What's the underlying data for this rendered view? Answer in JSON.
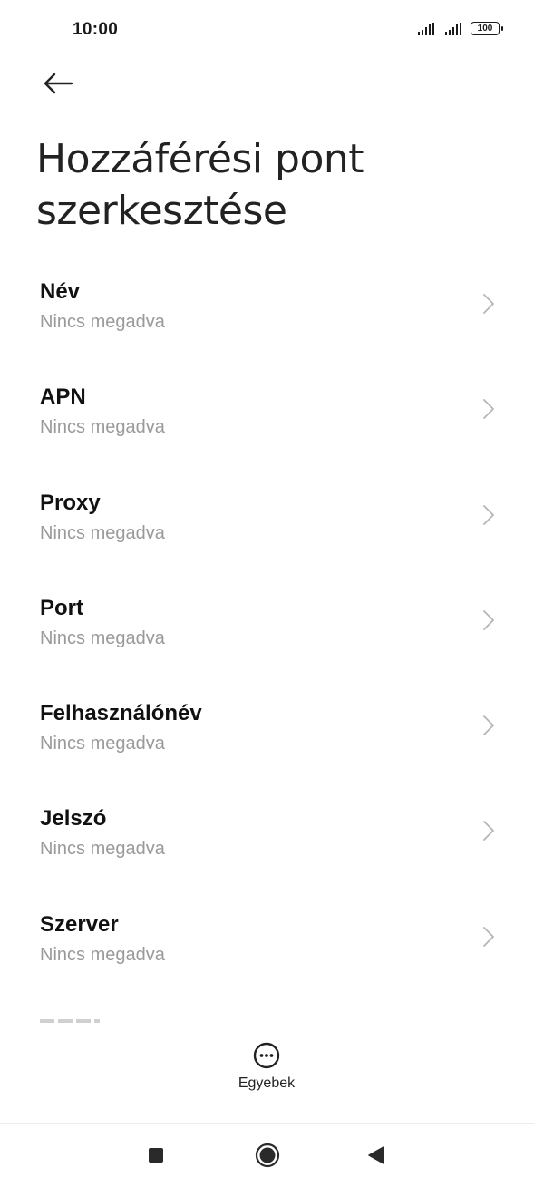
{
  "status_bar": {
    "time": "10:00",
    "battery": "100"
  },
  "header": {
    "title": "Hozzáférési pont\nszerkesztése"
  },
  "settings": {
    "items": [
      {
        "label": "Név",
        "value": "Nincs megadva"
      },
      {
        "label": "APN",
        "value": "Nincs megadva"
      },
      {
        "label": "Proxy",
        "value": "Nincs megadva"
      },
      {
        "label": "Port",
        "value": "Nincs megadva"
      },
      {
        "label": "Felhasználónév",
        "value": "Nincs megadva"
      },
      {
        "label": "Jelszó",
        "value": "Nincs megadva"
      },
      {
        "label": "Szerver",
        "value": "Nincs megadva"
      }
    ]
  },
  "bottom_action": {
    "label": "Egyebek",
    "icon": "more-circle-icon"
  },
  "nav_bar": {
    "recents_icon": "square-icon",
    "home_icon": "circle-icon",
    "back_icon": "triangle-back-icon"
  },
  "colors": {
    "background": "#ffffff",
    "text_primary": "#111111",
    "text_secondary": "#9a9a9a",
    "chevron": "#b5b5b5"
  }
}
